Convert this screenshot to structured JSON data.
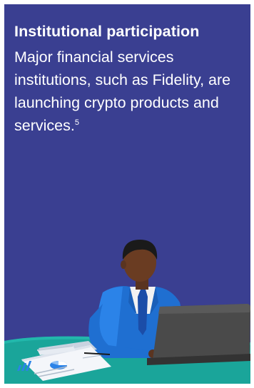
{
  "card": {
    "title": "Institutional participation",
    "body_text": "Major financial services institutions, such as Fidelity, are launching crypto products and services.",
    "footnote": "5"
  },
  "colors": {
    "background": "#3a3f91",
    "text": "#ffffff",
    "desk": "#1aa59a",
    "suit": "#1f6fd1",
    "laptop": "#4a4a4a"
  },
  "illustration": {
    "subject": "businessman-at-laptop-icon"
  }
}
